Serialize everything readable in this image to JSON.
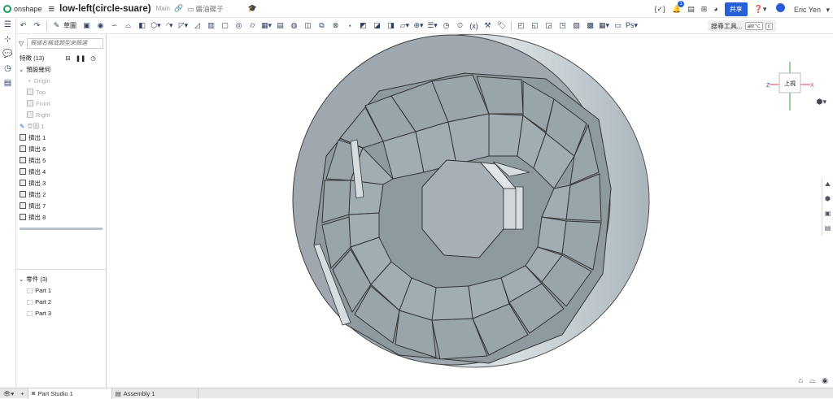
{
  "app": {
    "logo": "onshape"
  },
  "document": {
    "title": "low-left(circle-suare)",
    "branch": "Main",
    "folder": "醬油碟子"
  },
  "top_right": {
    "share_label": "共享",
    "user_name": "Eric Yen",
    "notification_count": "1"
  },
  "toolbar": {
    "sketch_label": "草圖",
    "search_tools_label": "搜尋工具...",
    "shortcut_1": "alt/⌥",
    "shortcut_2": "c"
  },
  "panel": {
    "filter_placeholder": "根據名稱或類型來篩選",
    "features_label": "特徵 (13)",
    "default_geometry_label": "預設幾何",
    "default_items": [
      "Origin",
      "Top",
      "Front",
      "Right"
    ],
    "sketch_label": "草圖 1",
    "features": [
      "擠出 1",
      "擠出 6",
      "擠出 5",
      "擠出 4",
      "擠出 3",
      "擠出 2",
      "擠出 7",
      "擠出 8"
    ],
    "parts_label": "零件 (3)",
    "parts": [
      "Part 1",
      "Part 2",
      "Part 3"
    ]
  },
  "viewcube": {
    "face_label": "上視",
    "axis_z": "Z",
    "axis_x": "X"
  },
  "tabs": [
    {
      "label": "Part Studio 1"
    },
    {
      "label": "Assembly 1"
    }
  ]
}
